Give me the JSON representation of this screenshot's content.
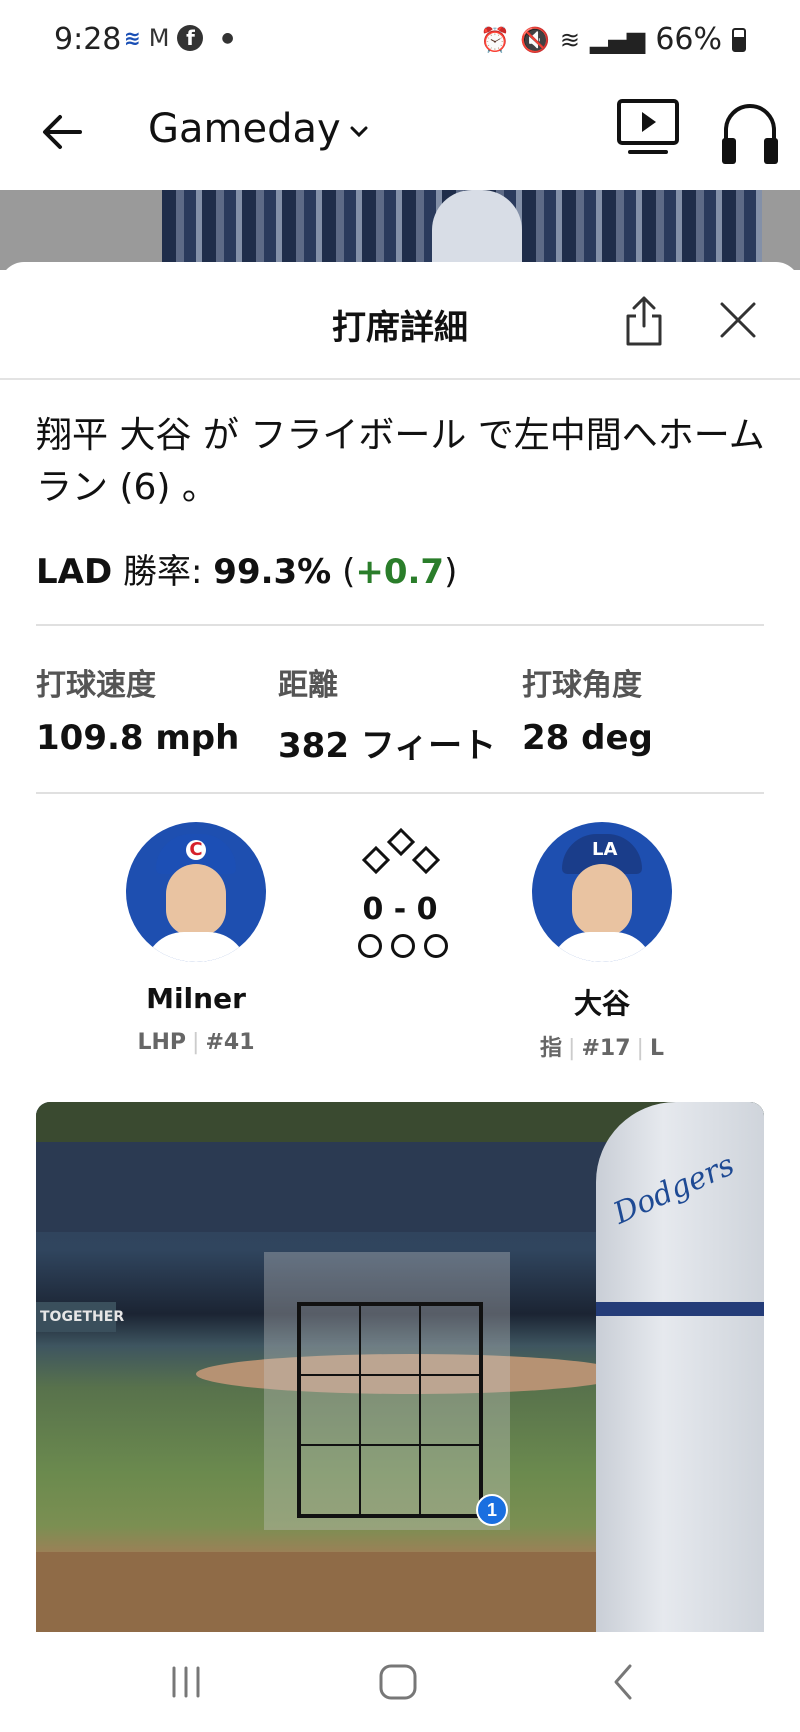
{
  "status_bar": {
    "time": "9:28",
    "left_icons": [
      "app-notification-icon",
      "gmail-icon",
      "facebook-icon",
      "dot-icon"
    ],
    "battery": "66%",
    "right_icons": [
      "alarm-icon",
      "mute-icon",
      "wifi-icon",
      "signal-icon",
      "battery-icon"
    ]
  },
  "app_bar": {
    "title": "Gameday",
    "chevron": "chevron-down-icon"
  },
  "sheet": {
    "title": "打席詳細",
    "description": "翔平 大谷 が フライボール で左中間へホームラン (6) 。",
    "win_prob": {
      "team": "LAD",
      "label": "勝率:",
      "value": "99.3%",
      "delta": "+0.7"
    },
    "stats": [
      {
        "label": "打球速度",
        "value": "109.8 mph"
      },
      {
        "label": "距離",
        "value": "382 フィート"
      },
      {
        "label": "打球角度",
        "value": "28 deg"
      }
    ]
  },
  "matchup": {
    "pitcher": {
      "name": "Milner",
      "throws": "LHP",
      "number": "#41"
    },
    "batter": {
      "name": "大谷",
      "position": "指",
      "number": "#17",
      "bats": "L"
    },
    "count": "0 - 0",
    "outs": 0,
    "bases_occupied": [
      false,
      false,
      false
    ]
  },
  "pitch_view": {
    "wall_text": "TOGETHER",
    "pitches": [
      {
        "number": "1"
      }
    ]
  },
  "colors": {
    "accent_blue": "#1a6fe0",
    "positive_green": "#2a7d2a",
    "cubs_blue": "#1c4fb5",
    "dodgers_blue": "#1a3d8a"
  }
}
